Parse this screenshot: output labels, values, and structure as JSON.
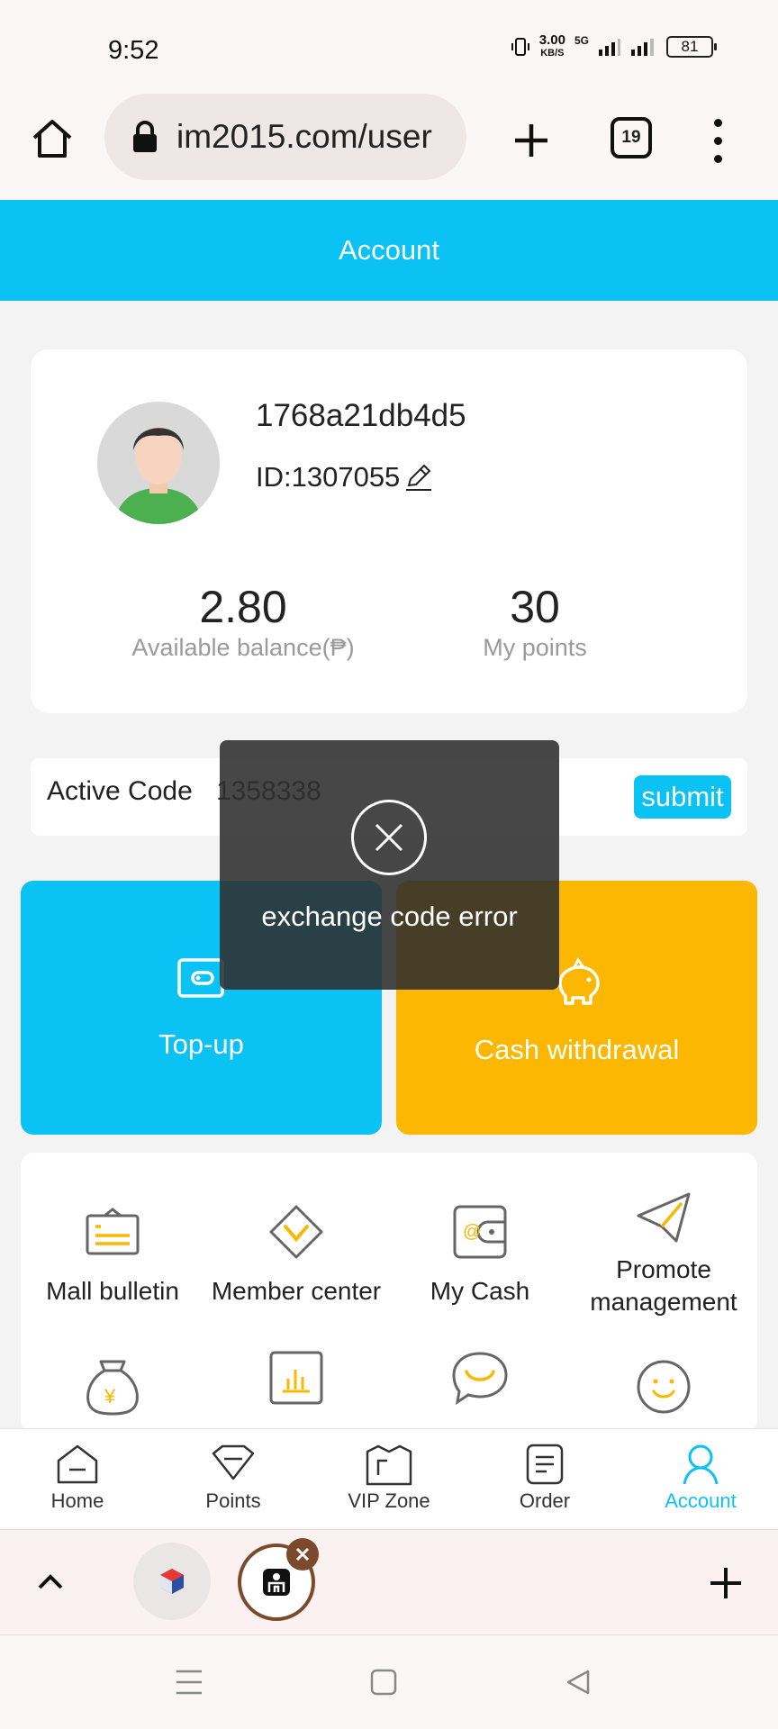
{
  "status_bar": {
    "time": "9:52",
    "net_speed_value": "3.00",
    "net_speed_unit": "KB/S",
    "network": "5G",
    "battery": "81"
  },
  "browser": {
    "url": "im2015.com/user",
    "tab_count": "19",
    "icons": [
      "home-icon",
      "lock-icon",
      "plus-icon",
      "tabs-icon",
      "more-vert-icon"
    ]
  },
  "page": {
    "title": "Account",
    "accent_color": "#0bc2f5",
    "secondary_color": "#fbb701"
  },
  "profile": {
    "username": "1768a21db4d5",
    "user_id": "ID:1307055",
    "balance_value": "2.80",
    "balance_label": "Available balance(₱)",
    "points_value": "30",
    "points_label": "My points"
  },
  "active_code": {
    "label": "Active Code",
    "value": "1358338",
    "submit_label": "submit"
  },
  "actions": {
    "topup_label": "Top-up",
    "withdraw_label": "Cash withdrawal"
  },
  "menu": {
    "items": [
      {
        "label": "Mall bulletin",
        "icon": "bulletin-icon"
      },
      {
        "label": "Member center",
        "icon": "diamond-icon"
      },
      {
        "label": "My Cash",
        "icon": "wallet-icon"
      },
      {
        "label": "Promote\nmanagement",
        "icon": "paper-plane-icon"
      },
      {
        "label": "",
        "icon": "money-bag-icon"
      },
      {
        "label": "",
        "icon": "chart-icon"
      },
      {
        "label": "",
        "icon": "chat-icon"
      },
      {
        "label": "",
        "icon": "smiley-icon"
      }
    ]
  },
  "toast": {
    "message": "exchange code error"
  },
  "bottom_nav": {
    "items": [
      {
        "label": "Home"
      },
      {
        "label": "Points"
      },
      {
        "label": "VIP Zone"
      },
      {
        "label": "Order"
      },
      {
        "label": "Account",
        "active": true
      }
    ]
  }
}
